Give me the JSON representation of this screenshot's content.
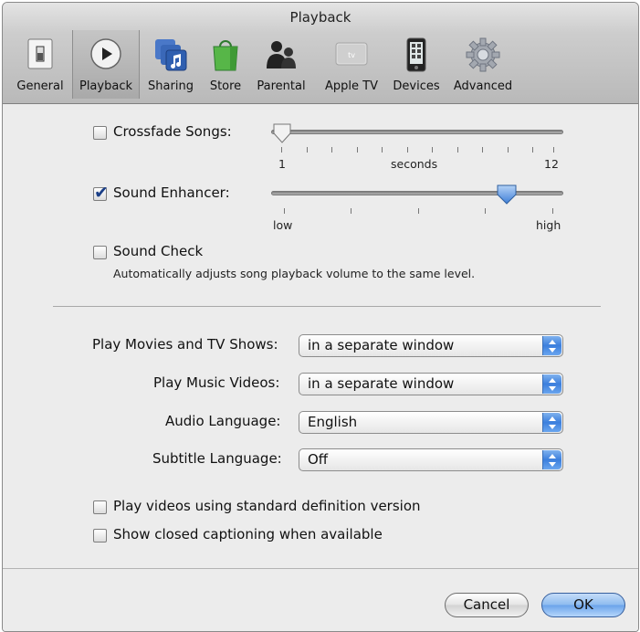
{
  "window": {
    "title": "Playback"
  },
  "toolbar": [
    {
      "label": "General",
      "icon": "general-icon"
    },
    {
      "label": "Playback",
      "icon": "playback-icon",
      "selected": true
    },
    {
      "label": "Sharing",
      "icon": "sharing-icon"
    },
    {
      "label": "Store",
      "icon": "store-icon"
    },
    {
      "label": "Parental",
      "icon": "parental-icon"
    },
    {
      "label": "Apple TV",
      "icon": "apple-tv-icon"
    },
    {
      "label": "Devices",
      "icon": "devices-icon"
    },
    {
      "label": "Advanced",
      "icon": "advanced-icon"
    }
  ],
  "appletv_badge": "tv",
  "crossfade": {
    "label": "Crossfade Songs:",
    "checked": false,
    "min_label": "1",
    "unit_label": "seconds",
    "max_label": "12",
    "value": 1
  },
  "enhancer": {
    "label": "Sound Enhancer:",
    "checked": true,
    "low_label": "low",
    "high_label": "high",
    "level": 0.8
  },
  "soundcheck": {
    "label": "Sound Check",
    "checked": false,
    "description": "Automatically adjusts song playback volume to the same level."
  },
  "popups": {
    "movies": {
      "label": "Play Movies and TV Shows:",
      "value": "in a separate window"
    },
    "music_videos": {
      "label": "Play Music Videos:",
      "value": "in a separate window"
    },
    "audio_language": {
      "label": "Audio Language:",
      "value": "English"
    },
    "subtitle_language": {
      "label": "Subtitle Language:",
      "value": "Off"
    }
  },
  "options": {
    "standard_definition": {
      "label": "Play videos using standard definition version",
      "checked": false
    },
    "closed_captioning": {
      "label": "Show closed captioning when available",
      "checked": false
    }
  },
  "buttons": {
    "cancel": "Cancel",
    "ok": "OK"
  },
  "colors": {
    "accent": "#3c7fdd",
    "checkmark": "#1b3f87"
  }
}
